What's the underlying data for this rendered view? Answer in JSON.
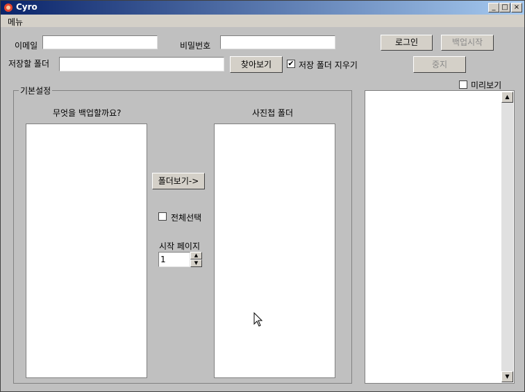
{
  "window": {
    "title": "Cyro",
    "minimize": "_",
    "maximize": "□",
    "close": "×"
  },
  "menu": {
    "items": [
      "메뉴"
    ]
  },
  "login": {
    "email_label": "이메일",
    "email_value": "",
    "password_label": "비밀번호",
    "password_value": "",
    "login_button": "로그인",
    "backup_start_button": "백업시작",
    "save_folder_label": "저장할 폴더",
    "save_folder_value": "",
    "browse_button": "찾아보기",
    "clear_folder_label": "저장 폴더 지우기",
    "clear_folder_checked": true,
    "stop_button": "중지"
  },
  "preview": {
    "label": "미리보기",
    "checked": false
  },
  "basic_settings": {
    "group_title": "기본설정",
    "what_to_backup_label": "무엇을 백업할까요?",
    "album_folder_label": "사진첩 폴더",
    "view_folder_button": "폴더보기->",
    "select_all_label": "전체선택",
    "select_all_checked": false,
    "start_page_label": "시작 페이지",
    "start_page_value": "1"
  },
  "icons": {
    "check": "✔",
    "scroll_up": "▲",
    "scroll_down": "▼",
    "spin_up": "▲",
    "spin_down": "▼"
  }
}
